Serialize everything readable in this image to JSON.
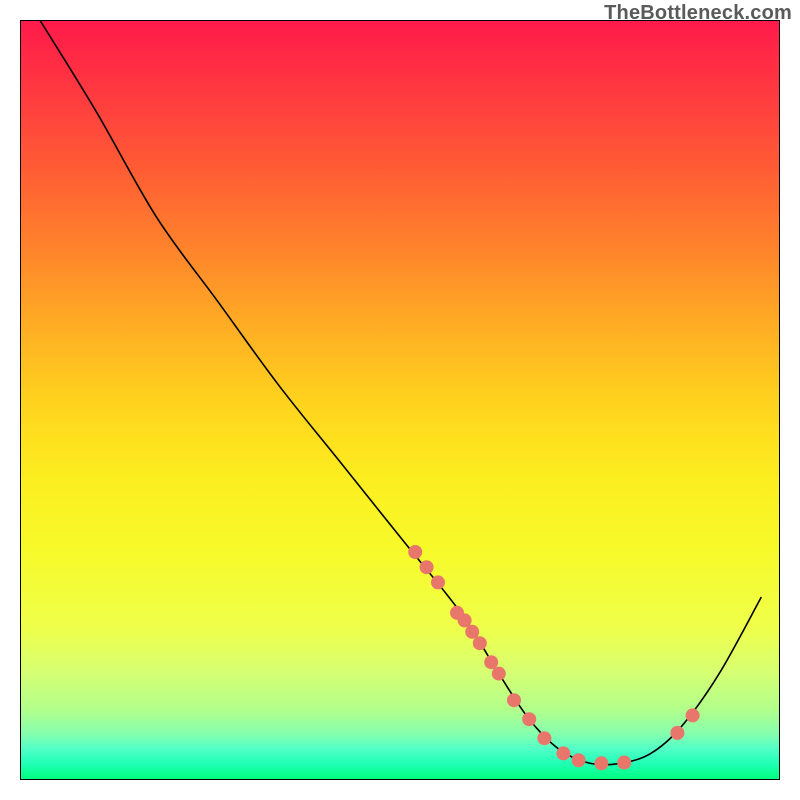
{
  "watermark": "TheBottleneck.com",
  "chart_data": {
    "type": "line",
    "title": "",
    "xlabel": "",
    "ylabel": "",
    "x_range": [
      0,
      100
    ],
    "y_range": [
      0,
      100
    ],
    "curve": [
      {
        "x": 2.6,
        "y": 100.0
      },
      {
        "x": 10.0,
        "y": 88.0
      },
      {
        "x": 18.0,
        "y": 74.0
      },
      {
        "x": 26.0,
        "y": 63.0
      },
      {
        "x": 34.0,
        "y": 52.0
      },
      {
        "x": 42.0,
        "y": 42.0
      },
      {
        "x": 50.0,
        "y": 32.0
      },
      {
        "x": 58.0,
        "y": 22.0
      },
      {
        "x": 63.0,
        "y": 14.0
      },
      {
        "x": 67.0,
        "y": 8.0
      },
      {
        "x": 71.0,
        "y": 4.0
      },
      {
        "x": 75.0,
        "y": 2.2
      },
      {
        "x": 79.0,
        "y": 2.2
      },
      {
        "x": 83.0,
        "y": 3.5
      },
      {
        "x": 87.0,
        "y": 7.0
      },
      {
        "x": 92.0,
        "y": 14.0
      },
      {
        "x": 97.5,
        "y": 24.0
      }
    ],
    "markers": [
      {
        "x": 52.0,
        "y": 30.0
      },
      {
        "x": 53.5,
        "y": 28.0
      },
      {
        "x": 55.0,
        "y": 26.0
      },
      {
        "x": 57.5,
        "y": 22.0
      },
      {
        "x": 58.5,
        "y": 21.0
      },
      {
        "x": 59.5,
        "y": 19.5
      },
      {
        "x": 60.5,
        "y": 18.0
      },
      {
        "x": 62.0,
        "y": 15.5
      },
      {
        "x": 63.0,
        "y": 14.0
      },
      {
        "x": 65.0,
        "y": 10.5
      },
      {
        "x": 67.0,
        "y": 8.0
      },
      {
        "x": 69.0,
        "y": 5.5
      },
      {
        "x": 71.5,
        "y": 3.5
      },
      {
        "x": 73.5,
        "y": 2.6
      },
      {
        "x": 76.5,
        "y": 2.2
      },
      {
        "x": 79.5,
        "y": 2.3
      },
      {
        "x": 86.5,
        "y": 6.2
      },
      {
        "x": 88.5,
        "y": 8.5
      }
    ],
    "marker_color": "#e8766b",
    "curve_color": "#000000",
    "curve_width": 1.6
  }
}
